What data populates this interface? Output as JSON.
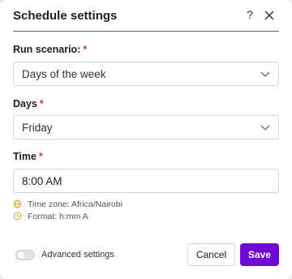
{
  "dialog": {
    "title": "Schedule settings",
    "help_label": "?"
  },
  "run_scenario": {
    "label": "Run scenario:",
    "required_mark": "*",
    "value": "Days of the week"
  },
  "days": {
    "label": "Days",
    "required_mark": "*",
    "value": "Friday"
  },
  "time": {
    "label": "Time",
    "required_mark": "*",
    "value": "8:00 AM",
    "timezone_hint": "Time zone: Africa/Nairobi",
    "format_hint": "Format: h:mm A"
  },
  "footer": {
    "advanced_label": "Advanced settings",
    "advanced_enabled": false,
    "cancel_label": "Cancel",
    "save_label": "Save"
  },
  "colors": {
    "accent": "#6e0ad1",
    "required": "#d9343a",
    "hint_icon": "#e0a030"
  },
  "icons": [
    "help-icon",
    "close-icon",
    "chevron-down-icon",
    "globe-icon",
    "clock-icon"
  ]
}
